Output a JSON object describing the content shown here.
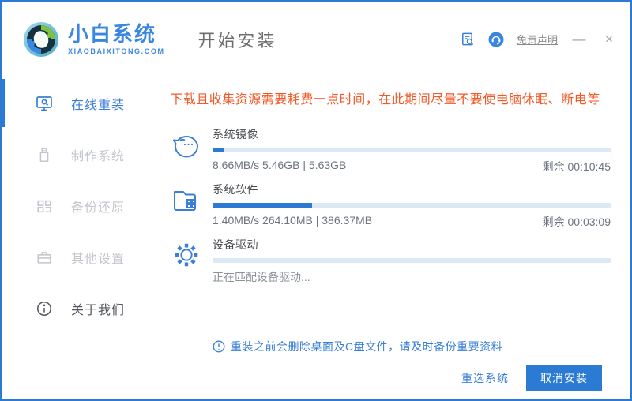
{
  "header": {
    "logo_title": "小白系统",
    "logo_subtitle": "XIAOBAIXITONG.COM",
    "page_title": "开始安装",
    "disclaimer_link": "免责声明",
    "minimize_label": "—",
    "close_label": "×"
  },
  "sidebar": {
    "items": [
      {
        "label": "在线重装",
        "icon": "monitor-icon",
        "active": true
      },
      {
        "label": "制作系统",
        "icon": "usb-icon",
        "active": false
      },
      {
        "label": "备份还原",
        "icon": "backup-blocks-icon",
        "active": false
      },
      {
        "label": "其他设置",
        "icon": "toolbox-icon",
        "active": false
      },
      {
        "label": "关于我们",
        "icon": "info-icon",
        "active": false
      }
    ]
  },
  "main": {
    "warning": "下载且收集资源需要耗费一点时间，在此期间尽量不要使电脑休眠、断电等",
    "tasks": [
      {
        "name": "系统镜像",
        "icon": "face-icon",
        "progress_percent": 3,
        "stats": "8.66MB/s 5.46GB | 5.63GB",
        "remaining": "剩余 00:10:45"
      },
      {
        "name": "系统软件",
        "icon": "folder-icon",
        "progress_percent": 25,
        "stats": "1.40MB/s 264.10MB | 386.37MB",
        "remaining": "剩余 00:03:09"
      },
      {
        "name": "设备驱动",
        "icon": "gear-icon",
        "progress_percent": 0,
        "stats": "正在匹配设备驱动...",
        "remaining": ""
      }
    ],
    "note": "重装之前会删除桌面及C盘文件，请及时备份重要资料"
  },
  "footer": {
    "reselect_label": "重选系统",
    "cancel_label": "取消安装"
  },
  "colors": {
    "accent_blue": "#2b7bd4",
    "link_blue": "#3a7fd5",
    "warning_orange": "#f25928",
    "progress_track": "#dde8f7"
  }
}
